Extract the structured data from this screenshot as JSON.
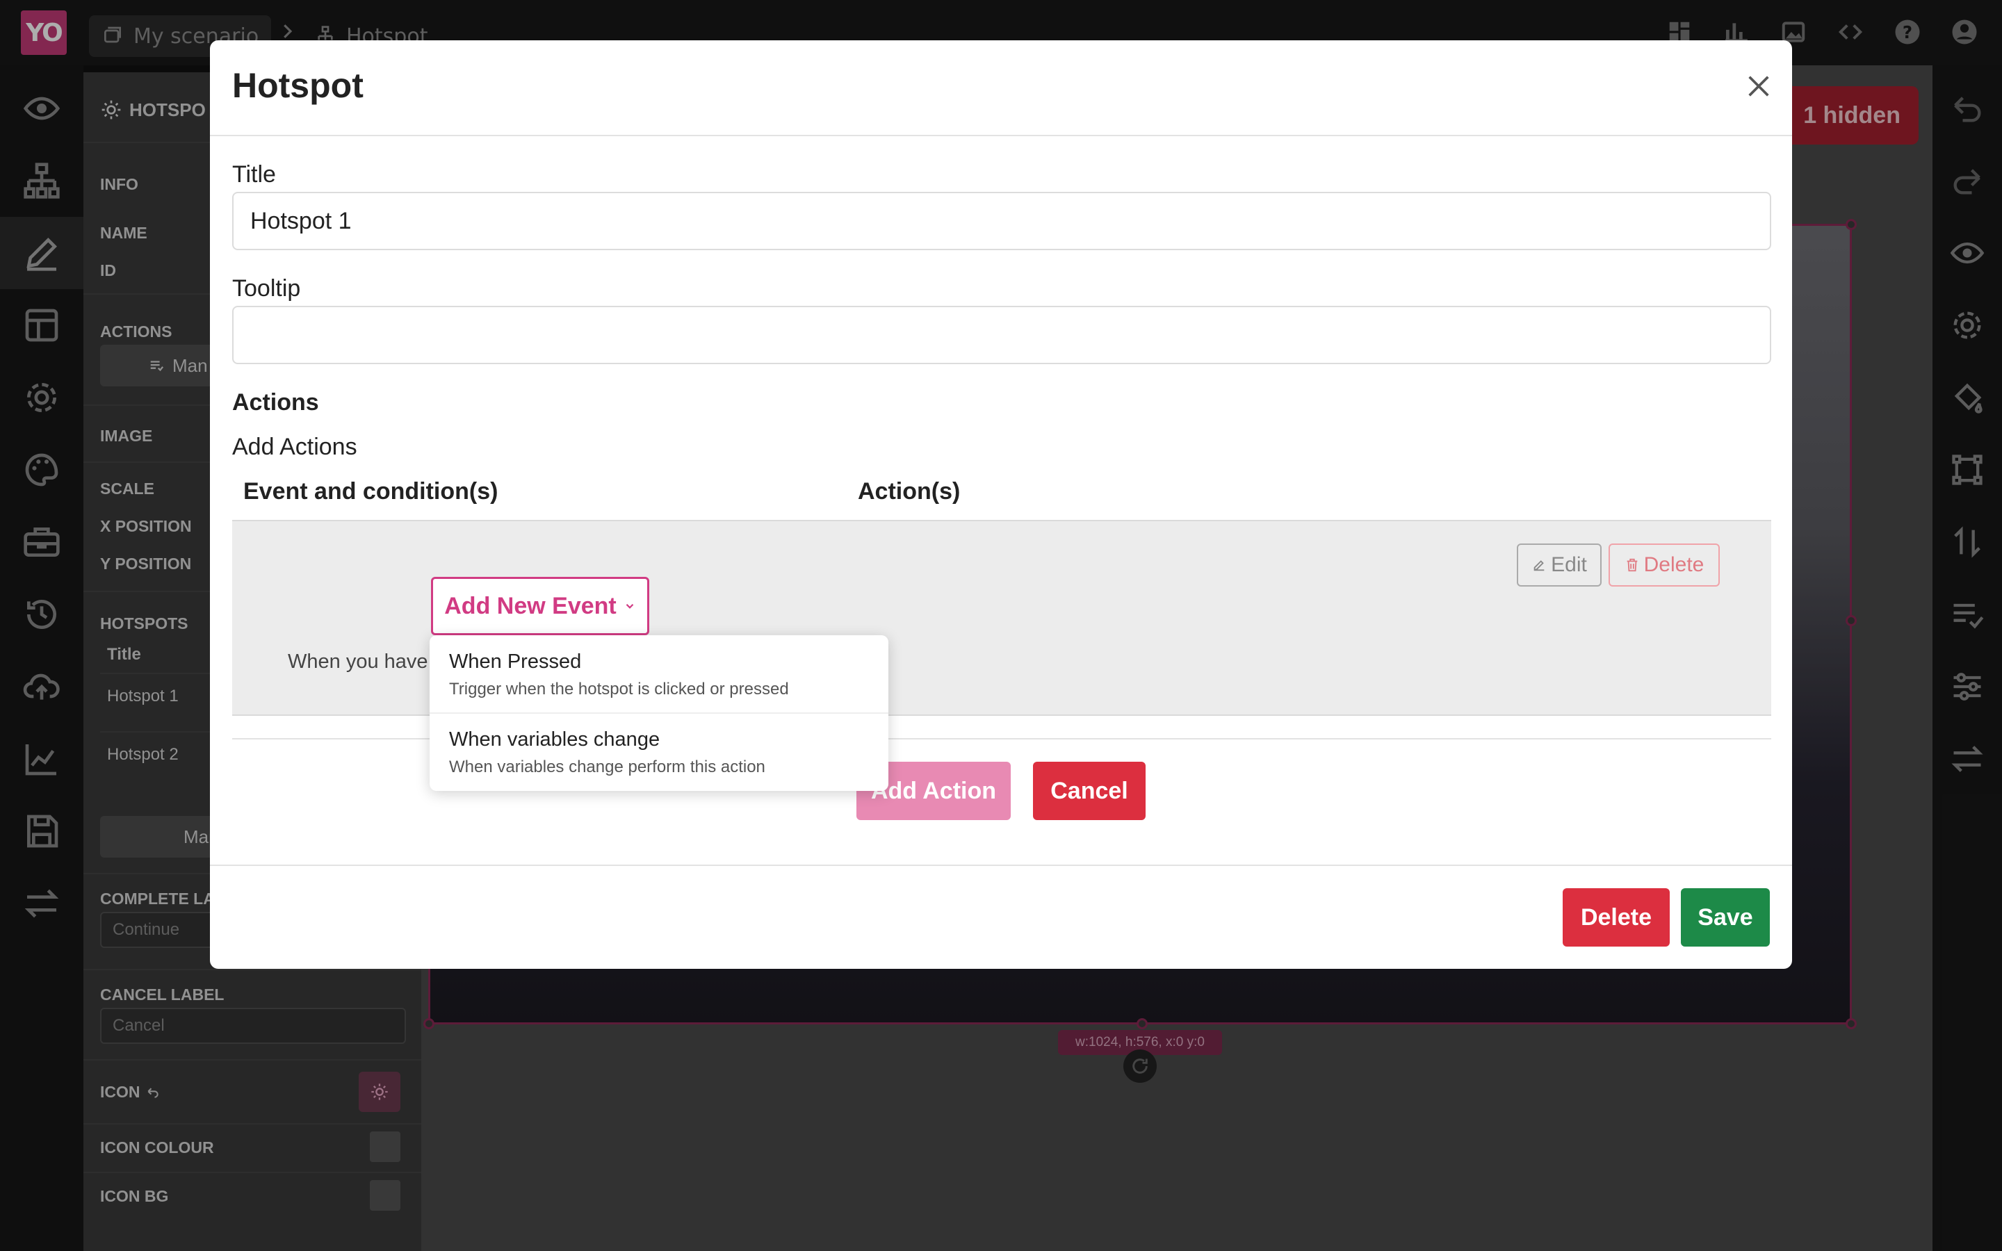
{
  "app": {
    "logo_text": "YO"
  },
  "breadcrumb": {
    "scenario": "My scenario",
    "page": "Hotspot"
  },
  "left_rail": {
    "icons": [
      "eye-icon",
      "sitemap-icon",
      "pencil-icon",
      "layout-icon",
      "gear-icon",
      "palette-icon",
      "toolbox-icon",
      "history-icon",
      "cloud-upload-icon",
      "chart-line-icon",
      "save-icon",
      "swap-icon"
    ]
  },
  "right_rail": {
    "icons": [
      "undo-icon",
      "redo-icon",
      "eye-icon",
      "gear-icon",
      "paint-bucket-icon",
      "vector-square-icon",
      "sort-icon",
      "list-check-icon",
      "sliders-icon",
      "arrows-exchange-icon"
    ]
  },
  "top_icons": [
    "dashboard-icon",
    "bar-chart-icon",
    "image-icon",
    "code-icon",
    "help-icon",
    "user-icon"
  ],
  "side_panel": {
    "header": "HOTSPO",
    "info_label": "INFO",
    "name_label": "NAME",
    "id_label": "ID",
    "actions_label": "ACTIONS",
    "manage_label": "Man",
    "image_label": "IMAGE",
    "scale_label": "SCALE",
    "x_position_label": "X POSITION",
    "y_position_label": "Y POSITION",
    "hotspots_label": "HOTSPOTS",
    "title_col": "Title",
    "hotspot_rows": [
      "Hotspot 1",
      "Hotspot 2"
    ],
    "manage2_label": "Mana",
    "complete_label": "COMPLETE LA",
    "complete_value": "Continue",
    "cancel_label": "CANCEL LABEL",
    "cancel_value": "Cancel",
    "icon_label": "ICON",
    "icon_colour_label": "ICON COLOUR",
    "icon_bg_label": "ICON BG"
  },
  "canvas": {
    "dim_label": "w:1024, h:576, x:0 y:0",
    "hidden_label": "1 hidden"
  },
  "modal": {
    "title": "Hotspot",
    "title_field_label": "Title",
    "title_value": "Hotspot 1",
    "tooltip_label": "Tooltip",
    "tooltip_value": "",
    "actions_heading": "Actions",
    "add_actions_label": "Add Actions",
    "col_event": "Event and condition(s)",
    "col_action": "Action(s)",
    "row_text": "When you have",
    "edit_label": "Edit",
    "delete_small_label": "Delete",
    "add_event_label": "Add New Event",
    "dropdown": [
      {
        "title": "When Pressed",
        "desc": "Trigger when the hotspot is clicked or pressed"
      },
      {
        "title": "When variables change",
        "desc": "When variables change perform this action"
      }
    ],
    "add_action_label": "Add Action",
    "cancel_label": "Cancel",
    "delete_label": "Delete",
    "save_label": "Save"
  },
  "colors": {
    "accent": "#d13b83",
    "danger": "#dc2f3f",
    "success": "#1d8a48"
  }
}
